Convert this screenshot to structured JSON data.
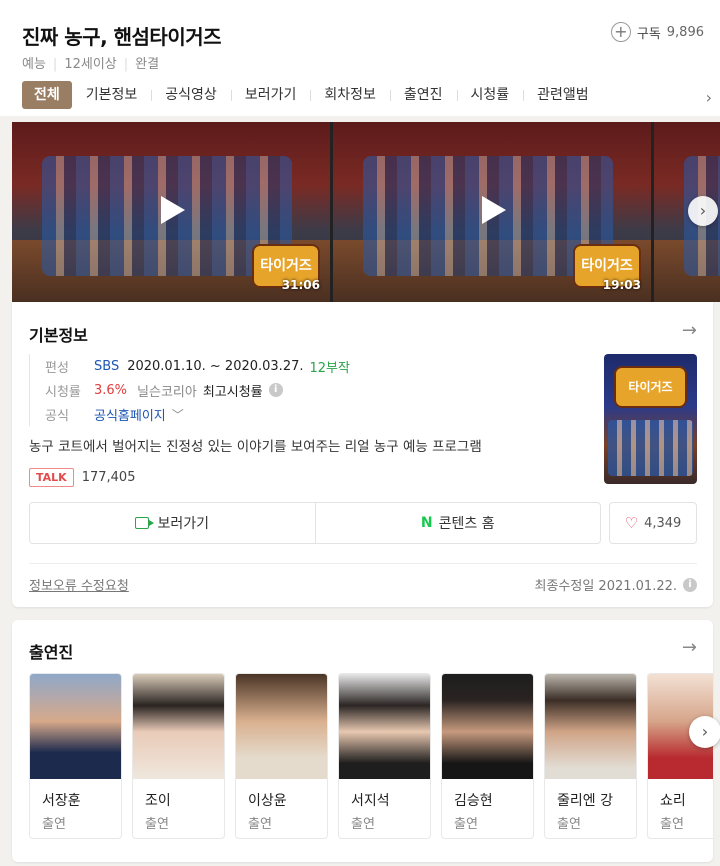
{
  "header": {
    "title": "진짜 농구, 핸섬타이거즈",
    "subscribe_label": "구독",
    "subscribe_count": "9,896",
    "meta": [
      "예능",
      "12세이상",
      "완결"
    ]
  },
  "tabs": [
    {
      "label": "전체",
      "active": true
    },
    {
      "label": "기본정보"
    },
    {
      "label": "공식영상"
    },
    {
      "label": "보러가기"
    },
    {
      "label": "회차정보"
    },
    {
      "label": "출연진"
    },
    {
      "label": "시청률"
    },
    {
      "label": "관련앨범"
    }
  ],
  "videos": [
    {
      "duration": "31:06",
      "logo": "타이거즈"
    },
    {
      "duration": "19:03",
      "logo": "타이거즈"
    }
  ],
  "info": {
    "section_title": "기본정보",
    "broadcast_label": "편성",
    "broadcaster": "SBS",
    "period": "2020.01.10. ~ 2020.03.27.",
    "episodes": "12부작",
    "ratings_label": "시청률",
    "rating_value": "3.6%",
    "rating_source": "닐슨코리아",
    "rating_type": "최고시청률",
    "official_label": "공식",
    "official_link": "공식홈페이지",
    "poster_logo": "타이거즈",
    "description": "농구 코트에서 벌어지는 진정성 있는 이야기를 보여주는 리얼 농구 예능 프로그램",
    "talk_badge": "TALK",
    "talk_count": "177,405",
    "watch_label": "보러가기",
    "content_home_icon": "N",
    "content_home_label": "콘텐츠 홈",
    "like_count": "4,349",
    "report_link": "정보오류 수정요청",
    "updated": "최종수정일 2021.01.22."
  },
  "cast": {
    "section_title": "출연진",
    "members": [
      {
        "name": "서장훈",
        "role": "출연"
      },
      {
        "name": "조이",
        "role": "출연"
      },
      {
        "name": "이상윤",
        "role": "출연"
      },
      {
        "name": "서지석",
        "role": "출연"
      },
      {
        "name": "김승현",
        "role": "출연"
      },
      {
        "name": "줄리엔 강",
        "role": "출연"
      },
      {
        "name": "쇼리",
        "role": "출연"
      }
    ]
  },
  "colors": {
    "active_tab": "#9a7e64",
    "link_blue": "#1d56b5",
    "green": "#2aa34b",
    "red": "#e13c3c"
  }
}
